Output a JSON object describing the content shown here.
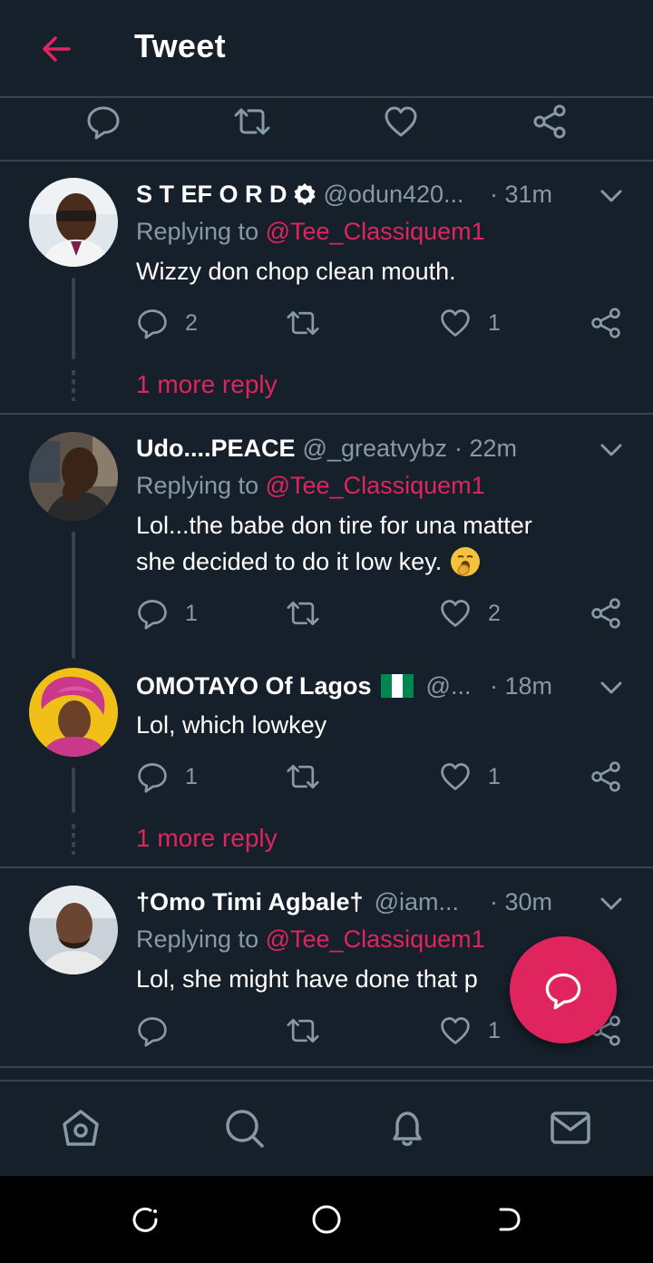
{
  "header": {
    "title": "Tweet"
  },
  "colors": {
    "accent": "#e0245e",
    "muted": "#8899a6",
    "background": "#15202b",
    "border": "#38444d"
  },
  "replies": [
    {
      "name": "S T EF O R D",
      "handle": "@odun420...",
      "time": "· 31m",
      "replying_prefix": "Replying to",
      "replying_to": "@Tee_Classiquem1",
      "text": "Wizzy don chop clean mouth.",
      "reply_count": "2",
      "retweet_count": "",
      "like_count": "1",
      "more_reply": "1 more reply"
    },
    {
      "name": "Udo....PEACE",
      "handle": "@_greatvybz",
      "time": "· 22m",
      "replying_prefix": "Replying to",
      "replying_to": "@Tee_Classiquem1",
      "text_line1": "Lol...the babe don tire for una matter",
      "text_line2": "she decided to do it low key.",
      "emoji": "🥱",
      "reply_count": "1",
      "retweet_count": "",
      "like_count": "2"
    },
    {
      "name": "OMOTAYO Of Lagos",
      "handle": "@...",
      "time": "· 18m",
      "text": "Lol, which lowkey",
      "reply_count": "1",
      "retweet_count": "",
      "like_count": "1",
      "more_reply": "1 more reply"
    },
    {
      "name": "†Omo Timi Agbale†",
      "handle": "@iam...",
      "time": "· 30m",
      "replying_prefix": "Replying to",
      "replying_to": "@Tee_Classiquem1",
      "text": "Lol, she might have done that p",
      "reply_count": "",
      "retweet_count": "",
      "like_count": "1"
    }
  ],
  "icons": {
    "back": "arrow-left-icon",
    "reply": "comment-icon",
    "retweet": "retweet-icon",
    "like": "heart-icon",
    "share": "share-icon",
    "home": "home-icon",
    "search": "search-icon",
    "notifications": "bell-icon",
    "messages": "mail-icon"
  }
}
